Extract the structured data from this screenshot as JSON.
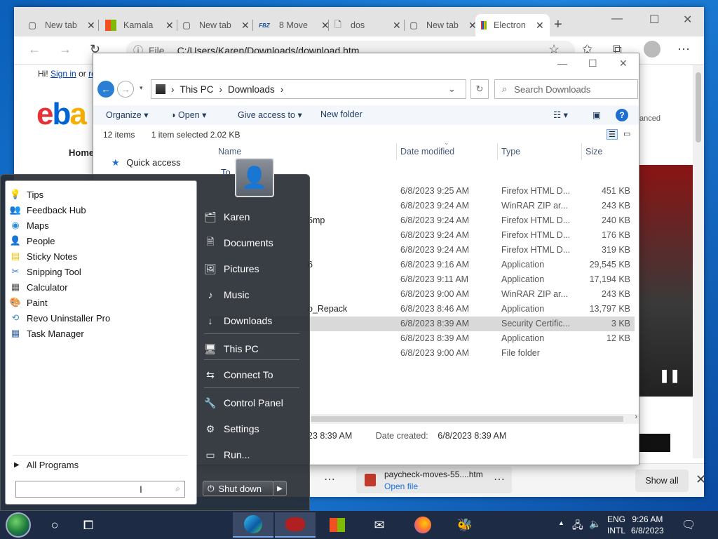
{
  "browser": {
    "tabs": [
      {
        "label": "New tab",
        "icon": "page-icon"
      },
      {
        "label": "Kamala",
        "icon": "microsoft-icon"
      },
      {
        "label": "New tab",
        "icon": "page-icon"
      },
      {
        "label": "8 Move",
        "icon": "fbz-icon",
        "icon_text": "FBZ"
      },
      {
        "label": "dos",
        "icon": "document-icon"
      },
      {
        "label": "New tab",
        "icon": "page-icon"
      },
      {
        "label": "Electron",
        "icon": "ebay-bag-icon"
      }
    ],
    "address": {
      "prefix": "File",
      "url": "C:/Users/Karen/Downloads/download.htm"
    }
  },
  "ebay": {
    "greeting": "Hi!",
    "sign_in": "Sign in",
    "or": "or",
    "register_partial": "re",
    "logo": "eba",
    "home_tab": "Home",
    "advanced": "anced"
  },
  "explorer": {
    "breadcrumb": [
      "This PC",
      "Downloads"
    ],
    "search_placeholder": "Search Downloads",
    "commands": {
      "organize": "Organize",
      "open": "Open",
      "give_access": "Give access to",
      "new_folder": "New folder"
    },
    "status": {
      "items": "12 items",
      "selected": "1 item selected  2.02 KB"
    },
    "columns": {
      "name": "Name",
      "date": "Date modified",
      "type": "Type",
      "size": "Size"
    },
    "nav": {
      "quick_access": "Quick access",
      "group_partial": "To"
    },
    "rows": [
      {
        "name": "",
        "date": "6/8/2023 9:25 AM",
        "type": "Firefox HTML D...",
        "size": "451 KB"
      },
      {
        "name": "",
        "date": "6/8/2023 9:24 AM",
        "type": "WinRAR ZIP ar...",
        "size": "243 KB"
      },
      {
        "name": "5mp",
        "date": "6/8/2023 9:24 AM",
        "type": "Firefox HTML D...",
        "size": "240 KB"
      },
      {
        "name": "",
        "date": "6/8/2023 9:24 AM",
        "type": "Firefox HTML D...",
        "size": "176 KB"
      },
      {
        "name": "",
        "date": "6/8/2023 9:24 AM",
        "type": "Firefox HTML D...",
        "size": "319 KB"
      },
      {
        "name": "6",
        "date": "6/8/2023 9:16 AM",
        "type": "Application",
        "size": "29,545 KB"
      },
      {
        "name": "",
        "date": "6/8/2023 9:11 AM",
        "type": "Application",
        "size": "17,194 KB"
      },
      {
        "name": "",
        "date": "6/8/2023 9:00 AM",
        "type": "WinRAR ZIP ar...",
        "size": "243 KB"
      },
      {
        "name": "o_Repack",
        "date": "6/8/2023 8:46 AM",
        "type": "Application",
        "size": "13,797 KB"
      },
      {
        "name": "",
        "date": "6/8/2023 8:39 AM",
        "type": "Security Certific...",
        "size": "3 KB",
        "selected": true
      },
      {
        "name": "",
        "date": "6/8/2023 8:39 AM",
        "type": "Application",
        "size": "12 KB"
      },
      {
        "name": "",
        "date": "6/8/2023 9:00 AM",
        "type": "File folder",
        "size": ""
      }
    ],
    "footer": {
      "modified_partial": "23 8:39 AM",
      "created_label": "Date created:",
      "created_value": "6/8/2023 8:39 AM"
    }
  },
  "start_menu": {
    "programs": [
      {
        "label": "Tips",
        "icon": "tips-icon"
      },
      {
        "label": "Feedback Hub",
        "icon": "feedback-hub-icon"
      },
      {
        "label": "Maps",
        "icon": "maps-icon"
      },
      {
        "label": "People",
        "icon": "people-icon"
      },
      {
        "label": "Sticky Notes",
        "icon": "sticky-notes-icon"
      },
      {
        "label": "Snipping Tool",
        "icon": "snipping-tool-icon"
      },
      {
        "label": "Calculator",
        "icon": "calculator-icon"
      },
      {
        "label": "Paint",
        "icon": "paint-icon"
      },
      {
        "label": "Revo Uninstaller Pro",
        "icon": "revo-uninstaller-icon"
      },
      {
        "label": "Task Manager",
        "icon": "task-manager-icon"
      }
    ],
    "all_programs": "All Programs",
    "right": [
      {
        "label": "Karen",
        "icon": "user-folder-icon"
      },
      {
        "label": "Documents",
        "icon": "documents-icon"
      },
      {
        "label": "Pictures",
        "icon": "pictures-icon"
      },
      {
        "label": "Music",
        "icon": "music-icon"
      },
      {
        "label": "Downloads",
        "icon": "downloads-icon"
      },
      {
        "label": "This PC",
        "icon": "computer-icon"
      },
      {
        "label": "Connect To",
        "icon": "connect-icon"
      },
      {
        "label": "Control Panel",
        "icon": "control-panel-icon"
      },
      {
        "label": "Settings",
        "icon": "settings-gear-icon"
      },
      {
        "label": "Run...",
        "icon": "run-icon"
      }
    ],
    "shutdown": "Shut down"
  },
  "downloads": {
    "file": "paycheck-moves-55....htm",
    "open": "Open file",
    "show_all": "Show all"
  },
  "taskbar": {
    "lang": "ENG",
    "layout": "INTL",
    "time": "9:26 AM",
    "date": "6/8/2023"
  },
  "colors": {
    "accent": "#1e6fd0",
    "taskbar": "#1d2b44",
    "start_menu": "#282d34"
  }
}
